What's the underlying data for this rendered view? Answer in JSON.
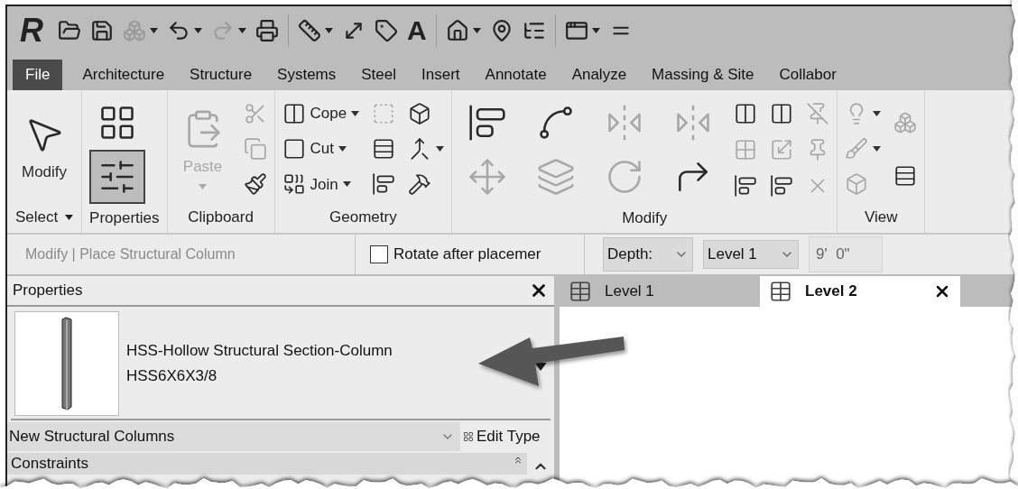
{
  "app_logo": "R",
  "quick_access": [
    {
      "kind": "icon",
      "disabled": false,
      "dropdown": false
    },
    {
      "kind": "icon",
      "disabled": false,
      "dropdown": false
    },
    {
      "kind": "icon",
      "disabled": true,
      "dropdown": true
    },
    {
      "kind": "icon",
      "disabled": false,
      "dropdown": true
    },
    {
      "kind": "icon",
      "disabled": true,
      "dropdown": true
    },
    {
      "kind": "icon",
      "disabled": false,
      "dropdown": false
    },
    {
      "kind": "separator"
    },
    {
      "kind": "icon",
      "disabled": false,
      "dropdown": true
    },
    {
      "kind": "icon",
      "disabled": false,
      "dropdown": false
    },
    {
      "kind": "icon",
      "disabled": false,
      "dropdown": false
    },
    {
      "kind": "glyph",
      "glyph": "A"
    },
    {
      "kind": "separator"
    },
    {
      "kind": "icon",
      "disabled": false,
      "dropdown": true
    },
    {
      "kind": "icon",
      "disabled": false,
      "dropdown": false
    },
    {
      "kind": "icon",
      "disabled": false,
      "dropdown": false
    },
    {
      "kind": "separator"
    },
    {
      "kind": "icon",
      "disabled": false,
      "dropdown": true
    },
    {
      "kind": "icon",
      "disabled": false,
      "dropdown": false
    }
  ],
  "ribbon_tabs": [
    {
      "label": "File",
      "kind": "file",
      "selected": false
    },
    {
      "label": "Architecture",
      "kind": "tab",
      "selected": false
    },
    {
      "label": "Structure",
      "kind": "tab",
      "selected": false
    },
    {
      "label": "Systems",
      "kind": "tab",
      "selected": false
    },
    {
      "label": "Steel",
      "kind": "tab",
      "selected": false
    },
    {
      "label": "Insert",
      "kind": "tab",
      "selected": false
    },
    {
      "label": "Annotate",
      "kind": "tab",
      "selected": false
    },
    {
      "label": "Analyze",
      "kind": "tab",
      "selected": false
    },
    {
      "label": "Massing & Site",
      "kind": "tab",
      "selected": false
    },
    {
      "label": "Collabor",
      "kind": "tab",
      "selected": false
    }
  ],
  "ribbon_panels": [
    {
      "label": "Select",
      "label_dropdown": true,
      "columns": [
        [
          {
            "kind": "large",
            "label": "Modify",
            "disabled": false,
            "dropdown": false
          }
        ]
      ]
    },
    {
      "label": "Properties",
      "label_dropdown": false,
      "columns": [
        [
          {
            "kind": "tile",
            "disabled": false,
            "selected": false
          },
          {
            "kind": "tile",
            "disabled": false,
            "selected": true
          }
        ]
      ]
    },
    {
      "label": "Clipboard",
      "label_dropdown": false,
      "columns": [
        [
          {
            "kind": "large",
            "label": "Paste",
            "disabled": true,
            "dropdown": true
          }
        ],
        [
          {
            "kind": "small",
            "disabled": true,
            "dropdown": false
          },
          {
            "kind": "small",
            "disabled": true,
            "dropdown": false
          },
          {
            "kind": "small",
            "disabled": false,
            "dropdown": false
          }
        ]
      ]
    },
    {
      "label": "Geometry",
      "label_dropdown": false,
      "columns": [
        [
          {
            "kind": "small",
            "label": "Cope",
            "disabled": false,
            "dropdown": true
          },
          {
            "kind": "small",
            "label": "Cut",
            "disabled": false,
            "dropdown": true
          },
          {
            "kind": "small",
            "label": "Join",
            "disabled": false,
            "dropdown": true
          }
        ],
        [
          {
            "kind": "small",
            "disabled": true,
            "dropdown": false
          },
          {
            "kind": "small",
            "disabled": false,
            "dropdown": false
          },
          {
            "kind": "small",
            "disabled": false,
            "dropdown": false
          }
        ],
        [
          {
            "kind": "small",
            "disabled": false,
            "dropdown": false
          },
          {
            "kind": "small",
            "disabled": false,
            "dropdown": true
          },
          {
            "kind": "small",
            "disabled": false,
            "dropdown": false
          }
        ]
      ]
    },
    {
      "label": "Modify",
      "label_dropdown": false,
      "columns": [
        [
          {
            "kind": "tile",
            "disabled": false,
            "selected": false
          },
          {
            "kind": "tile",
            "disabled": true,
            "selected": false
          }
        ],
        [
          {
            "kind": "tile",
            "disabled": false,
            "selected": false
          },
          {
            "kind": "tile",
            "disabled": true,
            "selected": false
          }
        ],
        [
          {
            "kind": "tile",
            "disabled": true,
            "selected": false
          },
          {
            "kind": "tile",
            "disabled": true,
            "selected": false
          }
        ],
        [
          {
            "kind": "tile",
            "disabled": true,
            "selected": false
          },
          {
            "kind": "tile",
            "disabled": false,
            "selected": false
          }
        ],
        [
          {
            "kind": "small",
            "disabled": false,
            "dropdown": false
          },
          {
            "kind": "small",
            "disabled": true,
            "dropdown": false
          },
          {
            "kind": "small",
            "disabled": false,
            "dropdown": false
          }
        ],
        [
          {
            "kind": "small",
            "disabled": false,
            "dropdown": false
          },
          {
            "kind": "small",
            "disabled": true,
            "dropdown": false
          },
          {
            "kind": "small",
            "disabled": false,
            "dropdown": false
          }
        ],
        [
          {
            "kind": "small",
            "disabled": true,
            "dropdown": false
          },
          {
            "kind": "small",
            "disabled": true,
            "dropdown": false
          },
          {
            "kind": "small",
            "disabled": true,
            "dropdown": false
          }
        ]
      ]
    },
    {
      "label": "View",
      "label_dropdown": false,
      "columns": [
        [
          {
            "kind": "small",
            "disabled": true,
            "dropdown": true
          },
          {
            "kind": "small",
            "disabled": true,
            "dropdown": true
          },
          {
            "kind": "small",
            "disabled": true,
            "dropdown": false
          }
        ],
        [
          {
            "kind": "small",
            "disabled": true,
            "dropdown": false
          },
          {
            "kind": "small",
            "disabled": false,
            "dropdown": false
          }
        ]
      ]
    }
  ],
  "options_bar": {
    "context": "Modify | Place Structural Column",
    "rotate": {
      "label": "Rotate after placemer",
      "checked": false
    },
    "depth": {
      "label": "Depth:"
    },
    "level": {
      "value": "Level 1"
    },
    "offset": {
      "value": "9'  0\""
    }
  },
  "properties": {
    "title": "Properties",
    "type_family": "HSS-Hollow Structural Section-Column",
    "type_name": "HSS6X6X3/8",
    "filter": "New Structural Columns",
    "edit_type": "Edit Type",
    "section": "Constraints"
  },
  "view_tabs": [
    {
      "label": "Level 1",
      "selected": false
    },
    {
      "label": "Level 2",
      "selected": true
    }
  ]
}
